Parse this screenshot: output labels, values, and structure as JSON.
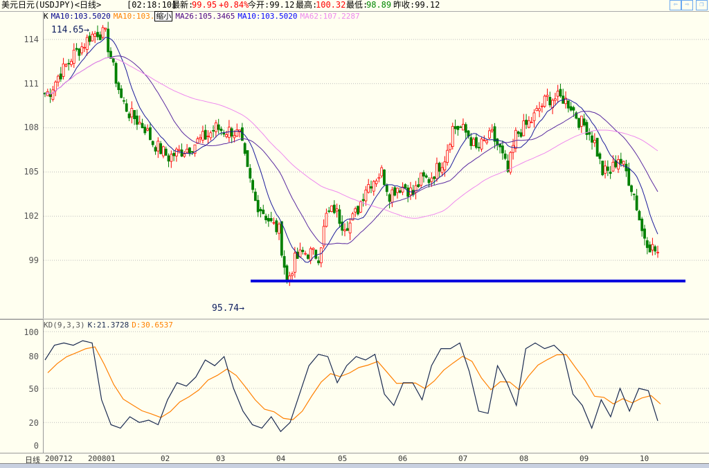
{
  "header": {
    "title": "美元日元(USDJPY)<日线>",
    "time": "[02:18:10]",
    "latest_label": "最新:",
    "latest": "99.95",
    "change": "+0.84%",
    "open": "今开:99.12",
    "high_label": "最高:",
    "high": "100.32",
    "low_label": "最低:",
    "low": "98.89",
    "prev": "昨收:99.12"
  },
  "legend": {
    "k": "K",
    "ma10a": "MA10:103.5020",
    "ma10b": "MA10:103.",
    "shrink": "缩小",
    "ma26": "MA26:105.3465",
    "ma10c": "MA10:103.5020",
    "ma62": "MA62:107.2287"
  },
  "kd_legend": {
    "name": "KD(9,3,3)",
    "k": "K:21.3728",
    "d": "D:30.6537"
  },
  "colors": {
    "up": "#FF0000",
    "down": "#008000",
    "ma10": "#1a1a9a",
    "ma26": "#5a2aa0",
    "ma62": "#ee88ee",
    "k": "#1a2a50",
    "d": "#ff8000",
    "support": "#0000dd"
  },
  "annotations": {
    "high": "114.65",
    "low": "95.74"
  },
  "price_ticks": [
    "114",
    "111",
    "108",
    "105",
    "102",
    "99"
  ],
  "kd_ticks": [
    "100",
    "80",
    "50",
    "20",
    "0"
  ],
  "period_label": "日线",
  "date_labels": [
    "200712",
    "200801",
    "02",
    "03",
    "04",
    "05",
    "06",
    "07",
    "08",
    "09",
    "10"
  ],
  "chart_data": {
    "type": "candlestick",
    "price_range": [
      94.5,
      115.5
    ],
    "support_level": 97.6,
    "closes": [
      110.2,
      110.5,
      111.5,
      112.2,
      113,
      113.5,
      114.2,
      114.5,
      114.3,
      112,
      110,
      109,
      108.5,
      108,
      107,
      106.5,
      106,
      106.3,
      106.5,
      106.8,
      107.2,
      107.5,
      108,
      107.8,
      107.8,
      107.5,
      105,
      103,
      102.3,
      101.5,
      101,
      97.5,
      99,
      99.5,
      99.5,
      99.3,
      102,
      102.5,
      101.5,
      101.5,
      102.5,
      104,
      104.5,
      105,
      103.5,
      104,
      104,
      103.5,
      104.5,
      104.5,
      105.2,
      106,
      108,
      108,
      107.5,
      106.5,
      107,
      107.5,
      106.5,
      105,
      107.5,
      108,
      108.5,
      109.3,
      110,
      110,
      110,
      109.5,
      108.5,
      108,
      107,
      105,
      105,
      106,
      105,
      103.5,
      101,
      100,
      99.5
    ],
    "kd": {
      "range": [
        0,
        100
      ],
      "K": [
        75,
        88,
        90,
        88,
        92,
        90,
        40,
        18,
        15,
        25,
        20,
        22,
        18,
        40,
        55,
        52,
        60,
        75,
        70,
        78,
        50,
        30,
        18,
        15,
        25,
        12,
        20,
        45,
        70,
        80,
        78,
        55,
        70,
        78,
        75,
        80,
        45,
        35,
        55,
        55,
        40,
        70,
        85,
        85,
        90,
        65,
        30,
        28,
        70,
        55,
        35,
        85,
        90,
        85,
        88,
        80,
        45,
        35,
        15,
        40,
        25,
        50,
        30,
        50,
        48,
        21.37
      ]
    }
  }
}
